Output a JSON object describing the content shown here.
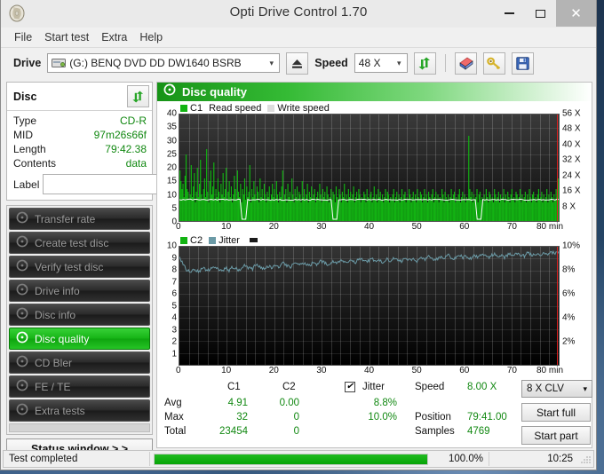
{
  "window": {
    "title": "Opti Drive Control 1.70",
    "icon": "disc-icon",
    "minimize": "–",
    "maximize": "□",
    "close": "✕"
  },
  "menu": {
    "items": [
      "File",
      "Start test",
      "Extra",
      "Help"
    ]
  },
  "toolbar": {
    "drive_label": "Drive",
    "drive_value": "(G:)   BENQ DVD DD DW1640 BSRB",
    "eject_icon": "eject-icon",
    "speed_label": "Speed",
    "speed_value": "48 X",
    "refresh_icon": "refresh-icon",
    "eraser_icon": "eraser-icon",
    "key_icon": "key-icon",
    "save_icon": "save-icon"
  },
  "disc_panel": {
    "title": "Disc",
    "refresh_icon": "refresh-icon",
    "rows": [
      {
        "key": "Type",
        "value": "CD-R"
      },
      {
        "key": "MID",
        "value": "97m26s66f"
      },
      {
        "key": "Length",
        "value": "79:42.38"
      },
      {
        "key": "Contents",
        "value": "data"
      }
    ],
    "label_key": "Label",
    "label_value": "",
    "label_placeholder": "",
    "disc_icon": "cd-icon"
  },
  "tests": {
    "items": [
      {
        "label": "Transfer rate",
        "active": false
      },
      {
        "label": "Create test disc",
        "active": false
      },
      {
        "label": "Verify test disc",
        "active": false
      },
      {
        "label": "Drive info",
        "active": false
      },
      {
        "label": "Disc info",
        "active": false
      },
      {
        "label": "Disc quality",
        "active": true
      },
      {
        "label": "CD Bler",
        "active": false
      },
      {
        "label": "FE / TE",
        "active": false
      },
      {
        "label": "Extra tests",
        "active": false
      }
    ],
    "status_window_button": "Status window > >"
  },
  "panel_header": {
    "title": "Disc quality",
    "icon": "disc-quality-icon"
  },
  "stats": {
    "col_c1": "C1",
    "col_c2": "C2",
    "row_avg": "Avg",
    "row_max": "Max",
    "row_total": "Total",
    "avg_c1": "4.91",
    "avg_c2": "0.00",
    "max_c1": "32",
    "max_c2": "0",
    "total_c1": "23454",
    "total_c2": "0",
    "jitter_label": "Jitter",
    "jitter_checked": "✔",
    "jitter_avg": "8.8%",
    "jitter_max": "10.0%",
    "speed_label": "Speed",
    "speed_value": "8.00 X",
    "position_label": "Position",
    "position_value": "79:41.00",
    "samples_label": "Samples",
    "samples_value": "4769",
    "write_strategy": "8 X CLV",
    "start_full": "Start full",
    "start_part": "Start part"
  },
  "statusbar": {
    "message": "Test completed",
    "progress_text": "100.0%",
    "progress_value": 100,
    "elapsed": "10:25"
  },
  "chart_data": [
    {
      "type": "bar",
      "name": "c1-error-chart",
      "title": "C1",
      "legend": [
        "C1",
        "Read speed",
        "Write speed"
      ],
      "legend_colors": [
        "#12b312",
        "#ffffff",
        "#d8d8d8"
      ],
      "xlabel": "min",
      "x_ticks": [
        "0",
        "10",
        "20",
        "30",
        "40",
        "50",
        "60",
        "70",
        "80 min"
      ],
      "xlim": [
        0,
        80
      ],
      "ylabel": "",
      "y_ticks": [
        "0",
        "5",
        "10",
        "15",
        "20",
        "25",
        "30",
        "35",
        "40"
      ],
      "ylim": [
        0,
        40
      ],
      "y2_ticks": [
        "8 X",
        "16 X",
        "24 X",
        "32 X",
        "40 X",
        "48 X",
        "56 X"
      ],
      "y2lim": [
        0,
        56
      ],
      "grid": true,
      "read_speed_value": 8,
      "series": [
        {
          "name": "C1",
          "color": "#12b312",
          "values": [
            19,
            15,
            12,
            14,
            9,
            17,
            25,
            12,
            11,
            8,
            10,
            21,
            9,
            13,
            18,
            7,
            11,
            20,
            9,
            14,
            23,
            10,
            8,
            12,
            16,
            9,
            27,
            11,
            7,
            15,
            19,
            10,
            13,
            22,
            8,
            12,
            9,
            16,
            11,
            7,
            14,
            10,
            18,
            9,
            12,
            20,
            8,
            11,
            15,
            9,
            13,
            7,
            10,
            17,
            12,
            8,
            19,
            11,
            9,
            14,
            7,
            12,
            10,
            16,
            8,
            13,
            9,
            11,
            21,
            7,
            12,
            9,
            15,
            10,
            8,
            13,
            11,
            7,
            16,
            9,
            12,
            8,
            14,
            10,
            7,
            11,
            9,
            13,
            8,
            10,
            14,
            9,
            12,
            8,
            15,
            10,
            7,
            11,
            9,
            13,
            19,
            8,
            10,
            12,
            7,
            14,
            9,
            11,
            8,
            16,
            10,
            7,
            12,
            9,
            13,
            8,
            11,
            10,
            7,
            15,
            9,
            12,
            8,
            10,
            14,
            7,
            11,
            9,
            13,
            8,
            10,
            12,
            7,
            9,
            11,
            8,
            14,
            10,
            7,
            12,
            9,
            11,
            8,
            13,
            10,
            7,
            9,
            12,
            8,
            11,
            10,
            7,
            13,
            9,
            8,
            12,
            10,
            7,
            11,
            9,
            14,
            8,
            10,
            7,
            12,
            9,
            11,
            8,
            10,
            13,
            7,
            9,
            11,
            8,
            12,
            10,
            7,
            9,
            8,
            11,
            10,
            7,
            12,
            9,
            8,
            10,
            11,
            7,
            9,
            13,
            8,
            10,
            7,
            12,
            9,
            11,
            8,
            10,
            7,
            9,
            12,
            8,
            11,
            10,
            7,
            9,
            8,
            10,
            12,
            7,
            9,
            11,
            8,
            10,
            7,
            9,
            12,
            8,
            10,
            11,
            7,
            9,
            8,
            12,
            10,
            7,
            9,
            11,
            8,
            10,
            7,
            12,
            9,
            8,
            11,
            10,
            7,
            9,
            12,
            8,
            10,
            7,
            11,
            9,
            8,
            10,
            12,
            7,
            9,
            11,
            8,
            10,
            7,
            9,
            8,
            12,
            10,
            7,
            11,
            9,
            8,
            10,
            7,
            9,
            12,
            8,
            10,
            11,
            7,
            9,
            8,
            10,
            12,
            7,
            9,
            11,
            8,
            10,
            7,
            9,
            8,
            32,
            12,
            9,
            11,
            7,
            10,
            8,
            9,
            12,
            7,
            10,
            11,
            8,
            9,
            7,
            10,
            8,
            12,
            9,
            7,
            11,
            10,
            8,
            9,
            7,
            12,
            10,
            8,
            9,
            11,
            7,
            10,
            8,
            9,
            12,
            7,
            10,
            8,
            11,
            9,
            7,
            10,
            12,
            8,
            9,
            7,
            11,
            10,
            8,
            9,
            12,
            7,
            10,
            8,
            9,
            11,
            7,
            10,
            8,
            12,
            9,
            7,
            10,
            11,
            8,
            9,
            7,
            10,
            12,
            8,
            9,
            11,
            7,
            10,
            8,
            9,
            12,
            7,
            10,
            8,
            11,
            9,
            7,
            10,
            8,
            12,
            9,
            16
          ]
        }
      ]
    },
    {
      "type": "line",
      "name": "c2-jitter-chart",
      "title": "C2 / Jitter",
      "legend": [
        "C2",
        "Jitter"
      ],
      "legend_colors": [
        "#12b312",
        "#6b9aa6"
      ],
      "xlabel": "min",
      "x_ticks": [
        "0",
        "10",
        "20",
        "30",
        "40",
        "50",
        "60",
        "70",
        "80 min"
      ],
      "xlim": [
        0,
        80
      ],
      "y_ticks": [
        "1",
        "2",
        "3",
        "4",
        "5",
        "6",
        "7",
        "8",
        "9",
        "10"
      ],
      "ylim": [
        0,
        10
      ],
      "y2_ticks": [
        "2%",
        "4%",
        "6%",
        "8%",
        "10%"
      ],
      "y2lim": [
        0,
        10
      ],
      "grid": true,
      "series": [
        {
          "name": "Jitter",
          "color": "#6b9aa6",
          "unit": "%",
          "values": [
            9.1,
            8.5,
            8.0,
            7.9,
            8.1,
            7.9,
            8.2,
            8.0,
            8.1,
            8.3,
            8.1,
            7.9,
            8.2,
            8.0,
            8.3,
            8.1,
            8.0,
            8.4,
            8.2,
            8.1,
            8.5,
            8.3,
            8.1,
            8.4,
            8.2,
            8.5,
            8.3,
            8.6,
            8.4,
            8.3,
            8.6,
            8.4,
            8.7,
            8.5,
            8.4,
            8.7,
            8.5,
            8.8,
            8.6,
            8.5,
            8.8,
            8.6,
            8.9,
            8.7,
            8.6,
            8.9,
            8.7,
            9.0,
            8.8,
            8.7,
            9.0,
            8.8,
            8.9,
            8.7,
            9.0,
            8.8,
            9.1,
            8.9,
            8.8,
            9.1,
            8.9,
            9.0,
            8.8,
            9.1,
            8.9,
            9.2,
            9.0,
            8.9,
            9.2,
            9.0,
            9.3,
            9.1,
            9.0,
            9.3,
            9.1,
            9.2,
            9.0,
            9.3,
            9.1,
            9.4,
            9.2,
            9.1,
            9.4,
            9.2,
            9.3,
            9.1,
            9.4,
            9.2,
            9.5,
            9.3,
            9.2,
            9.5,
            9.3,
            9.4,
            9.2,
            9.5,
            9.3,
            9.6,
            9.4,
            9.5
          ]
        },
        {
          "name": "C2",
          "color": "#12b312",
          "values": []
        }
      ]
    }
  ]
}
